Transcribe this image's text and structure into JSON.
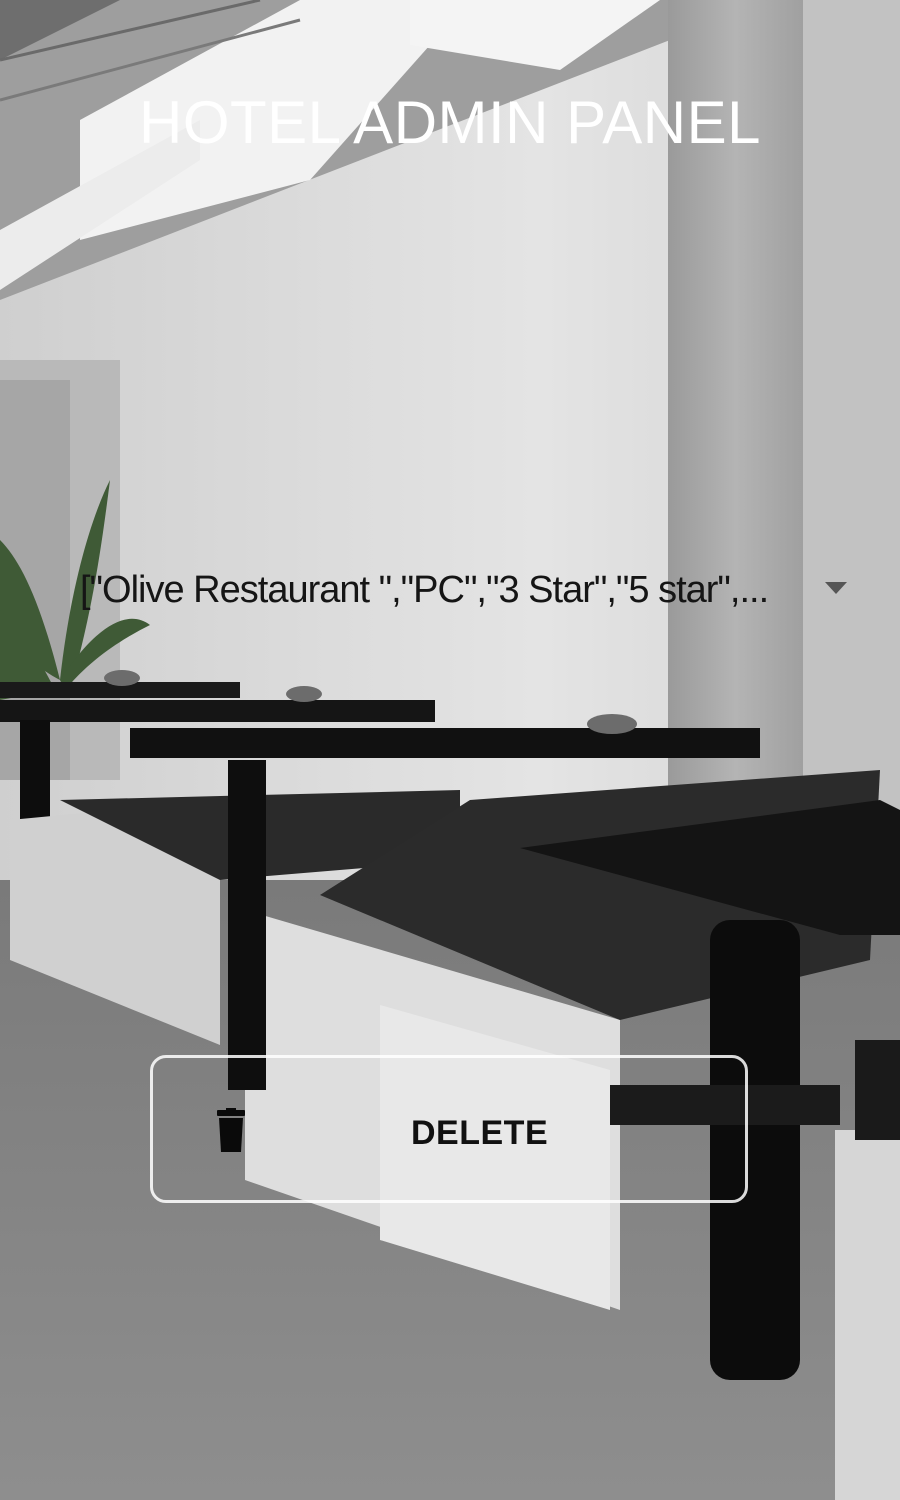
{
  "header": {
    "title": "HOTEL ADMIN PANEL"
  },
  "selector": {
    "selected_value": "[\"Olive Restaurant \",\"PC\",\"3 Star\",\"5 star\",..."
  },
  "actions": {
    "delete_label": "DELETE"
  },
  "icons": {
    "delete": "trash-icon",
    "dropdown": "dropdown-arrow-icon"
  },
  "colors": {
    "title_text": "#ffffff",
    "button_border": "#ffffff",
    "text_dark": "#111111"
  }
}
